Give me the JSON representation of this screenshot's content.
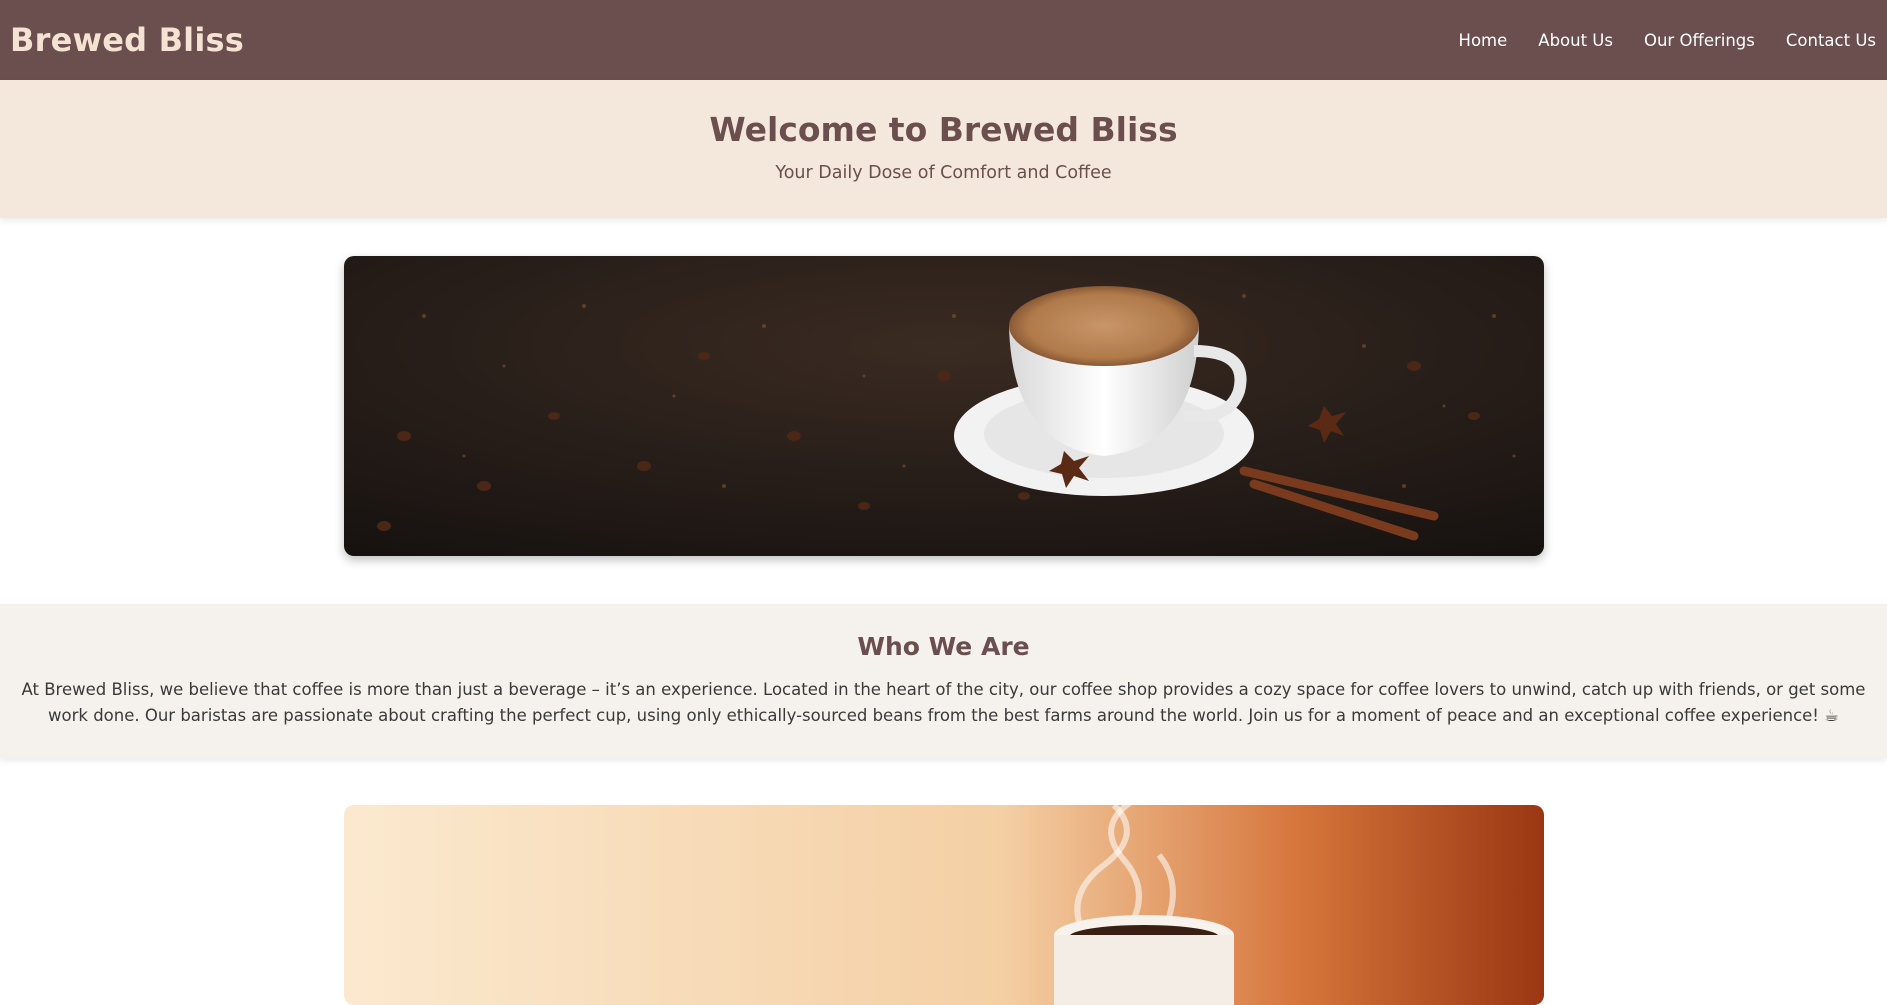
{
  "header": {
    "brand": "Brewed Bliss",
    "nav": [
      "Home",
      "About Us",
      "Our Offerings",
      "Contact Us"
    ]
  },
  "hero": {
    "title": "Welcome to Brewed Bliss",
    "subtitle": "Your Daily Dose of Comfort and Coffee"
  },
  "about": {
    "title": "Who We Are",
    "text": "At Brewed Bliss, we believe that coffee is more than just a beverage – it’s an experience. Located in the heart of the city, our coffee shop provides a cozy space for coffee lovers to unwind, catch up with friends, or get some work done. Our baristas are passionate about crafting the perfect cup, using only ethically-sourced beans from the best farms around the world. Join us for a moment of peace and an exceptional coffee experience! ☕"
  },
  "colors": {
    "nav_bg": "#6b4f4f",
    "brand": "#f4e3d3",
    "hero_bg": "#f4e8dd",
    "about_bg": "#f5f1ec"
  }
}
